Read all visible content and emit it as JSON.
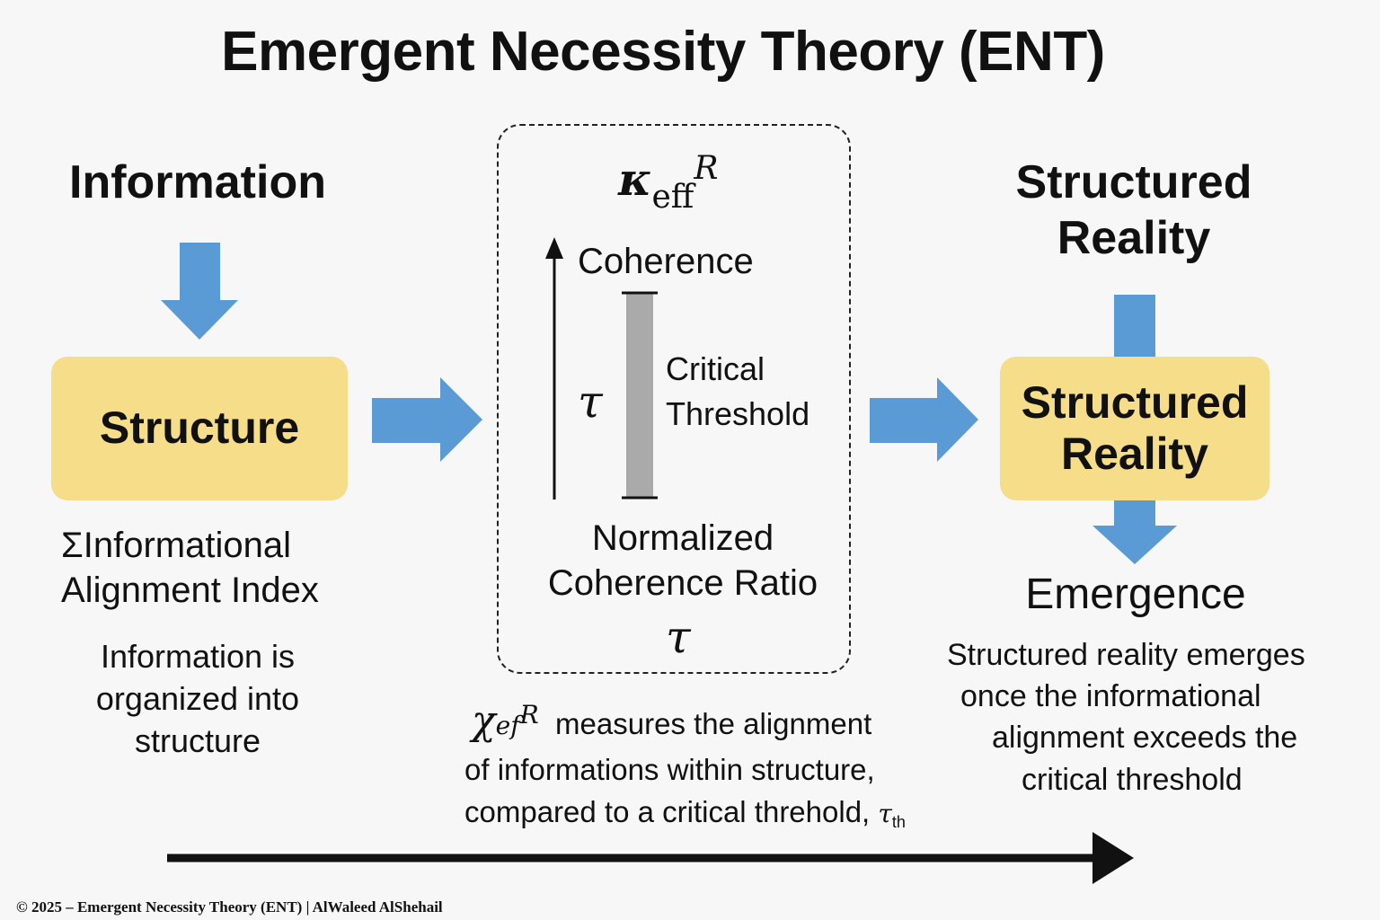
{
  "title": "Emergent Necessity Theory (ENT)",
  "left": {
    "heading": "Information",
    "box_label": "Structure",
    "index_symbol": "Σ",
    "index_label_1": "Informational",
    "index_label_2": "Alignment Index",
    "desc_1": "Information is",
    "desc_2": "organized into",
    "desc_3": "structure"
  },
  "middle": {
    "kappa_symbol": "κ",
    "kappa_sub": "eff",
    "kappa_sup": "R",
    "coherence_label": "Coherence",
    "tau_symbol": "τ",
    "threshold_label_1": "Critical",
    "threshold_label_2": "Threshold",
    "ratio_label_1": "Normalized",
    "ratio_label_2": "Coherence Ratio",
    "ratio_symbol": "τ"
  },
  "caption": {
    "chi_symbol": "χ",
    "chi_sub": "ef",
    "chi_sup": "R",
    "line_1": "measures the alignment",
    "line_2": "of informations within structure,",
    "line_3": "compared to a critical threhold,",
    "tau_symbol": "τ",
    "tau_sub": "th"
  },
  "right": {
    "heading_1": "Structured",
    "heading_2": "Reality",
    "box_label_1": "Structured",
    "box_label_2": "Reality",
    "emergence_label": "Emergence",
    "desc_1": "Structured reality emerges",
    "desc_2": "once the informational",
    "desc_3": "alignment exceeds the",
    "desc_4": "critical threshold"
  },
  "footer": "© 2025 – Emergent Necessity Theory (ENT) | AlWaleed AlShehail",
  "colors": {
    "arrow_blue": "#5b9bd5",
    "box_yellow": "#f6dd8a",
    "threshold_bar": "#aaaaaa"
  }
}
